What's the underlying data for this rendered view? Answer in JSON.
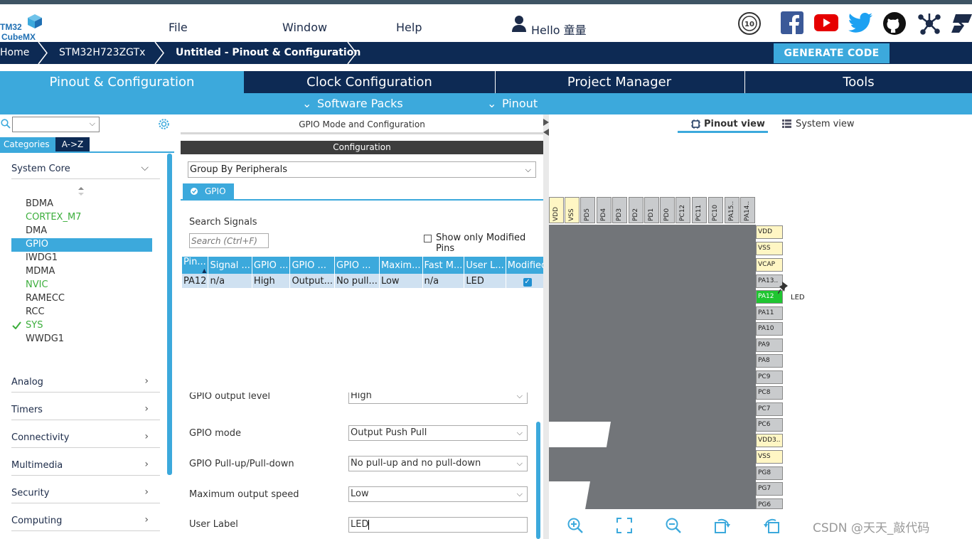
{
  "logo": {
    "line1": "TM32",
    "line2": "CubeMX"
  },
  "menu": {
    "file": "File",
    "window": "Window",
    "help": "Help",
    "user": "Hello 童量"
  },
  "breadcrumb": {
    "home": "Home",
    "device": "STM32H723ZGTx",
    "current": "Untitled - Pinout & Configuration"
  },
  "generate_code": "GENERATE CODE",
  "tabs": [
    {
      "label": "Pinout & Configuration",
      "active": true
    },
    {
      "label": "Clock Configuration",
      "active": false
    },
    {
      "label": "Project Manager",
      "active": false
    },
    {
      "label": "Tools",
      "active": false
    }
  ],
  "subtabs": {
    "software_packs": "Software Packs",
    "pinout": "Pinout"
  },
  "left": {
    "tab_categories": "Categories",
    "tab_az": "A->Z",
    "system_core": "System Core",
    "items": [
      {
        "label": "BDMA",
        "state": "normal"
      },
      {
        "label": "CORTEX_M7",
        "state": "green"
      },
      {
        "label": "DMA",
        "state": "normal"
      },
      {
        "label": "GPIO",
        "state": "selected"
      },
      {
        "label": "IWDG1",
        "state": "normal"
      },
      {
        "label": "MDMA",
        "state": "normal"
      },
      {
        "label": "NVIC",
        "state": "green"
      },
      {
        "label": "RAMECC",
        "state": "normal"
      },
      {
        "label": "RCC",
        "state": "normal"
      },
      {
        "label": "SYS",
        "state": "check"
      },
      {
        "label": "WWDG1",
        "state": "normal"
      }
    ],
    "groups": [
      "Analog",
      "Timers",
      "Connectivity",
      "Multimedia",
      "Security",
      "Computing"
    ]
  },
  "middle": {
    "title": "GPIO Mode and Configuration",
    "config_header": "Configuration",
    "group_by": "Group By Peripherals",
    "gpio_tab": "GPIO",
    "search_label": "Search Signals",
    "search_placeholder": "Search (Ctrl+F)",
    "show_modified": "Show only Modified Pins",
    "table_headers": [
      "Pin...",
      "Signal ...",
      "GPIO ...",
      "GPIO ...",
      "GPIO ...",
      "Maxim...",
      "Fast M...",
      "User L...",
      "Modified"
    ],
    "table_rows": [
      [
        "PA12",
        "n/a",
        "High",
        "Output...",
        "No pull...",
        "Low",
        "n/a",
        "LED",
        "✓"
      ]
    ],
    "fields": [
      {
        "label": "GPIO output level",
        "value": "High"
      },
      {
        "label": "GPIO mode",
        "value": "Output Push Pull"
      },
      {
        "label": "GPIO Pull-up/Pull-down",
        "value": "No pull-up and no pull-down"
      },
      {
        "label": "Maximum output speed",
        "value": "Low"
      },
      {
        "label": "User Label",
        "value": "LED"
      }
    ]
  },
  "right": {
    "pinout_view": "Pinout view",
    "system_view": "System view",
    "top_pins": [
      "VDD",
      "VSS",
      "PD5",
      "PD4",
      "PD3",
      "PD2",
      "PD1",
      "PD0",
      "PC12",
      "PC11",
      "PC10",
      "PA15..",
      "PA14.."
    ],
    "right_pins": [
      "VDD",
      "VSS",
      "VCAP",
      "PA13..",
      "PA12",
      "PA11",
      "PA10",
      "PA9",
      "PA8",
      "PC9",
      "PC8",
      "PC7",
      "PC6",
      "VDD3..",
      "VSS",
      "PG8",
      "PG7",
      "PG6"
    ],
    "pin_label": "LED"
  },
  "watermark": "CSDN @天天_敲代码"
}
